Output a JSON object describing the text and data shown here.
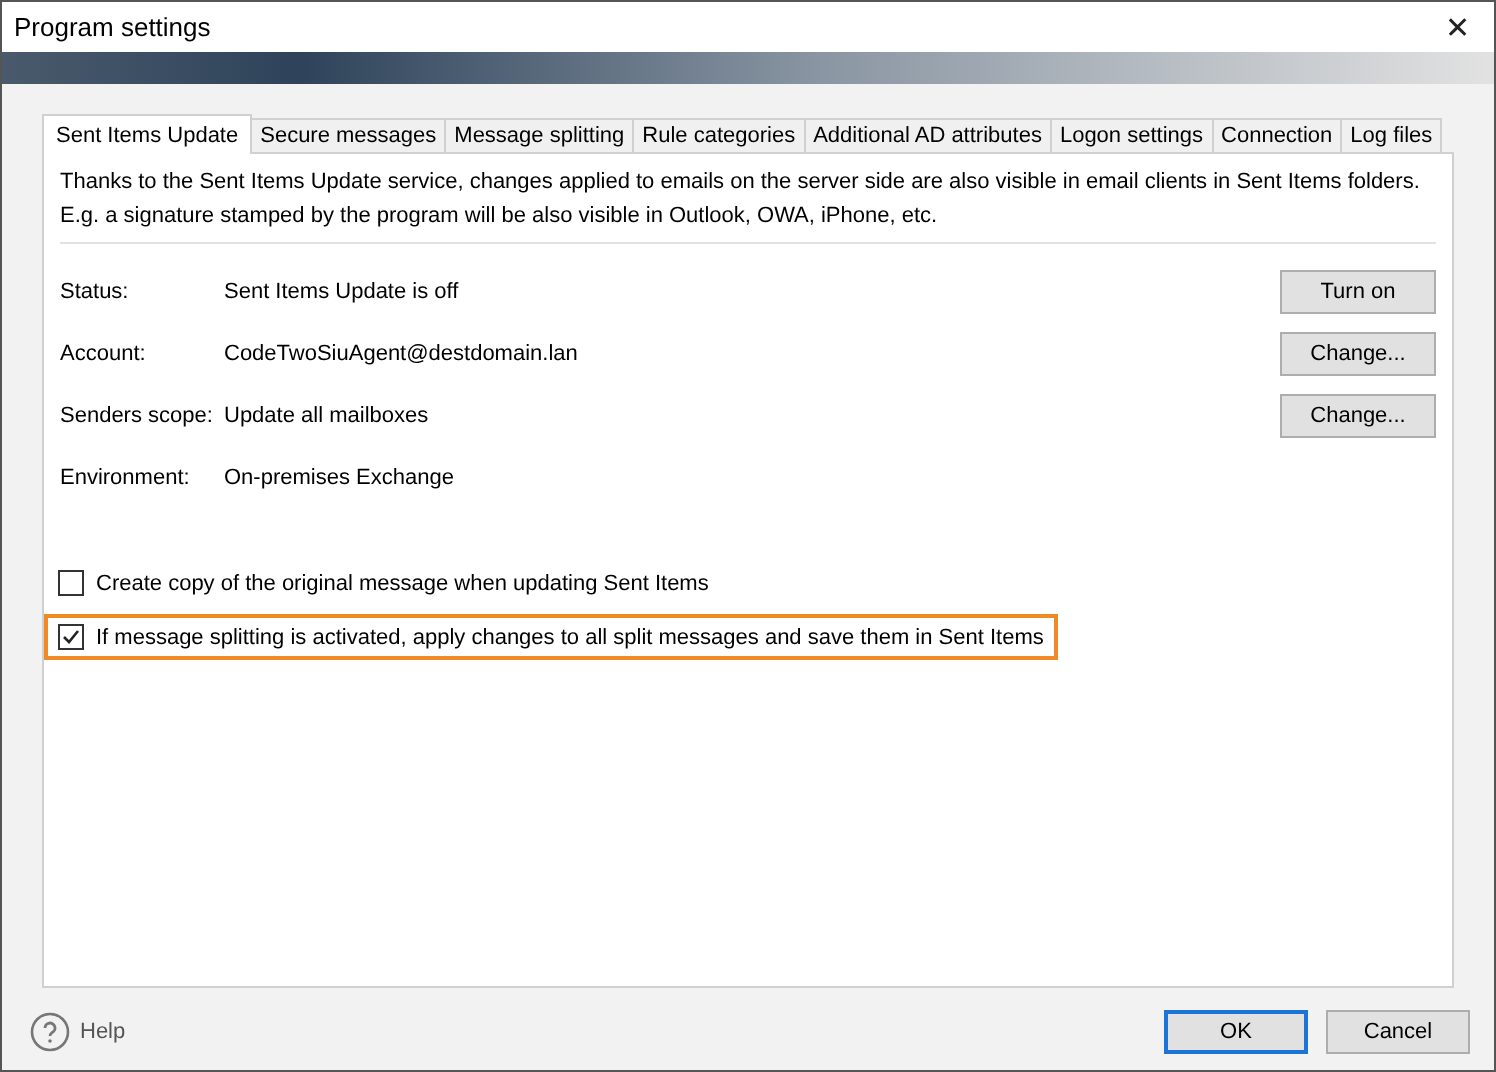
{
  "window": {
    "title": "Program settings",
    "close": "✕"
  },
  "tabs": [
    {
      "label": "Sent Items Update",
      "selected": true
    },
    {
      "label": "Secure messages",
      "selected": false
    },
    {
      "label": "Message splitting",
      "selected": false
    },
    {
      "label": "Rule categories",
      "selected": false
    },
    {
      "label": "Additional AD attributes",
      "selected": false
    },
    {
      "label": "Logon settings",
      "selected": false
    },
    {
      "label": "Connection",
      "selected": false
    },
    {
      "label": "Log files",
      "selected": false
    }
  ],
  "description": "Thanks to the Sent Items Update service, changes applied to emails on the server side are also visible in email clients in Sent Items folders. E.g. a signature stamped by the program will be also visible in Outlook, OWA, iPhone, etc.",
  "fields": [
    {
      "label": "Status:",
      "value": "Sent Items Update is off",
      "button": "Turn on"
    },
    {
      "label": "Account:",
      "value": "CodeTwoSiuAgent@destdomain.lan",
      "button": "Change..."
    },
    {
      "label": "Senders scope:",
      "value": "Update all mailboxes",
      "button": "Change..."
    },
    {
      "label": "Environment:",
      "value": "On-premises Exchange"
    }
  ],
  "options": [
    {
      "label": "Create copy of the original message when updating Sent Items",
      "checked": false,
      "highlighted": false
    },
    {
      "label": "If message splitting is activated, apply changes to all split messages and save them in Sent Items",
      "checked": true,
      "highlighted": true
    }
  ],
  "footer": {
    "help": "Help",
    "buttons": [
      {
        "label": "OK",
        "default": true
      },
      {
        "label": "Cancel",
        "default": false
      }
    ]
  }
}
